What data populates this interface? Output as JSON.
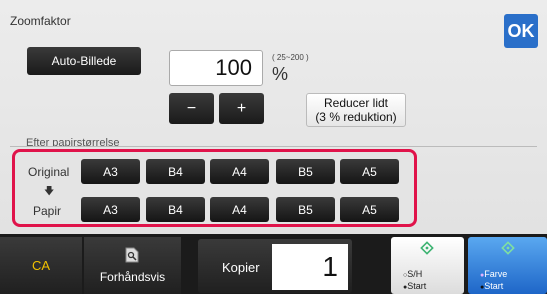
{
  "dialog": {
    "title": "Zoomfaktor",
    "ok_label": "OK",
    "auto_label": "Auto-Billede",
    "zoom_value": "100",
    "zoom_range": "( 25~200 )",
    "zoom_unit": "%",
    "minus_label": "−",
    "plus_label": "+",
    "reduce_label_1": "Reducer lidt",
    "reduce_label_2": "(3 % reduktion)",
    "section_label": "Efter papirstørrelse",
    "original_label": "Original",
    "paper_label": "Papir",
    "arrow_glyph": "🡇",
    "original_sizes": [
      "A3",
      "B4",
      "A4",
      "B5",
      "A5"
    ],
    "paper_sizes": [
      "A3",
      "B4",
      "A4",
      "B5",
      "A5"
    ]
  },
  "bottom": {
    "ca_label": "CA",
    "preview_label": "Forhåndsvis",
    "copies_label": "Kopier",
    "copies_value": "1",
    "bw_label_1": "S/H",
    "bw_label_2": "Start",
    "color_label_1": "Farve",
    "color_label_2": "Start"
  },
  "colors": {
    "accent": "#2a6fc9",
    "highlight": "#e0134a",
    "ca": "#f0c000",
    "start_icon": "#3cb371"
  }
}
